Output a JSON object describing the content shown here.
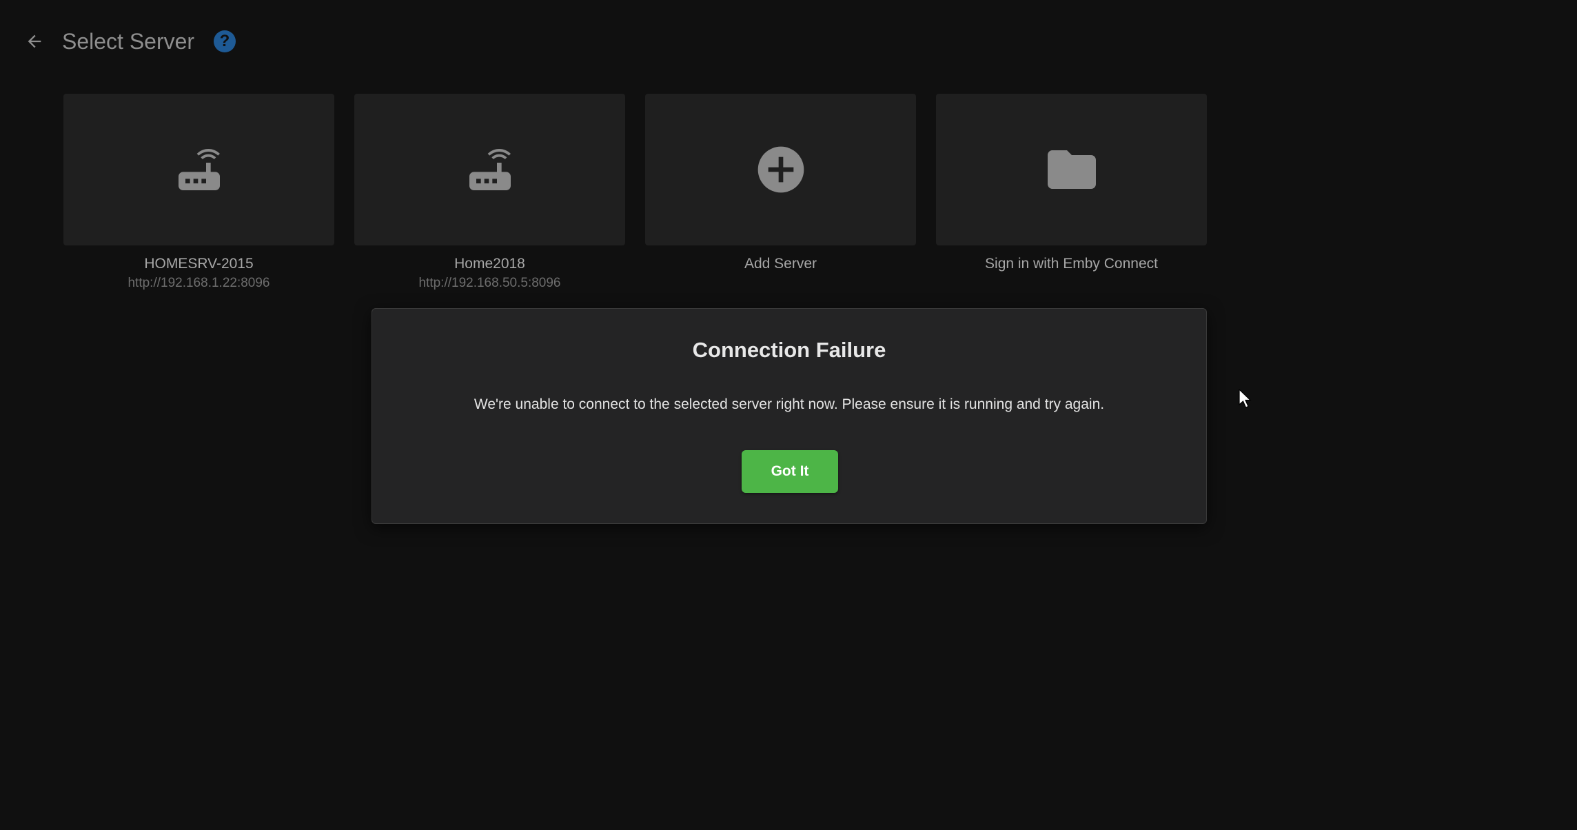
{
  "header": {
    "title": "Select Server",
    "help_label": "?",
    "back_icon": "arrow-left-icon"
  },
  "servers": [
    {
      "name": "HOMESRV-2015",
      "address": "http://192.168.1.22:8096",
      "icon": "router-icon"
    },
    {
      "name": "Home2018",
      "address": "http://192.168.50.5:8096",
      "icon": "router-icon"
    }
  ],
  "actions": {
    "add_server": {
      "label": "Add Server",
      "icon": "add-circle-icon"
    },
    "emby_connect": {
      "label": "Sign in with Emby Connect",
      "icon": "folder-icon"
    }
  },
  "dialog": {
    "title": "Connection Failure",
    "message": "We're unable to connect to the selected server right now. Please ensure it is running and try again.",
    "button_label": "Got It"
  },
  "colors": {
    "background": "#101010",
    "card": "#1f1f1f",
    "icon": "#8a8a8a",
    "help": "#1e5a95",
    "accent_green": "#4db547",
    "dialog": "#242425"
  }
}
